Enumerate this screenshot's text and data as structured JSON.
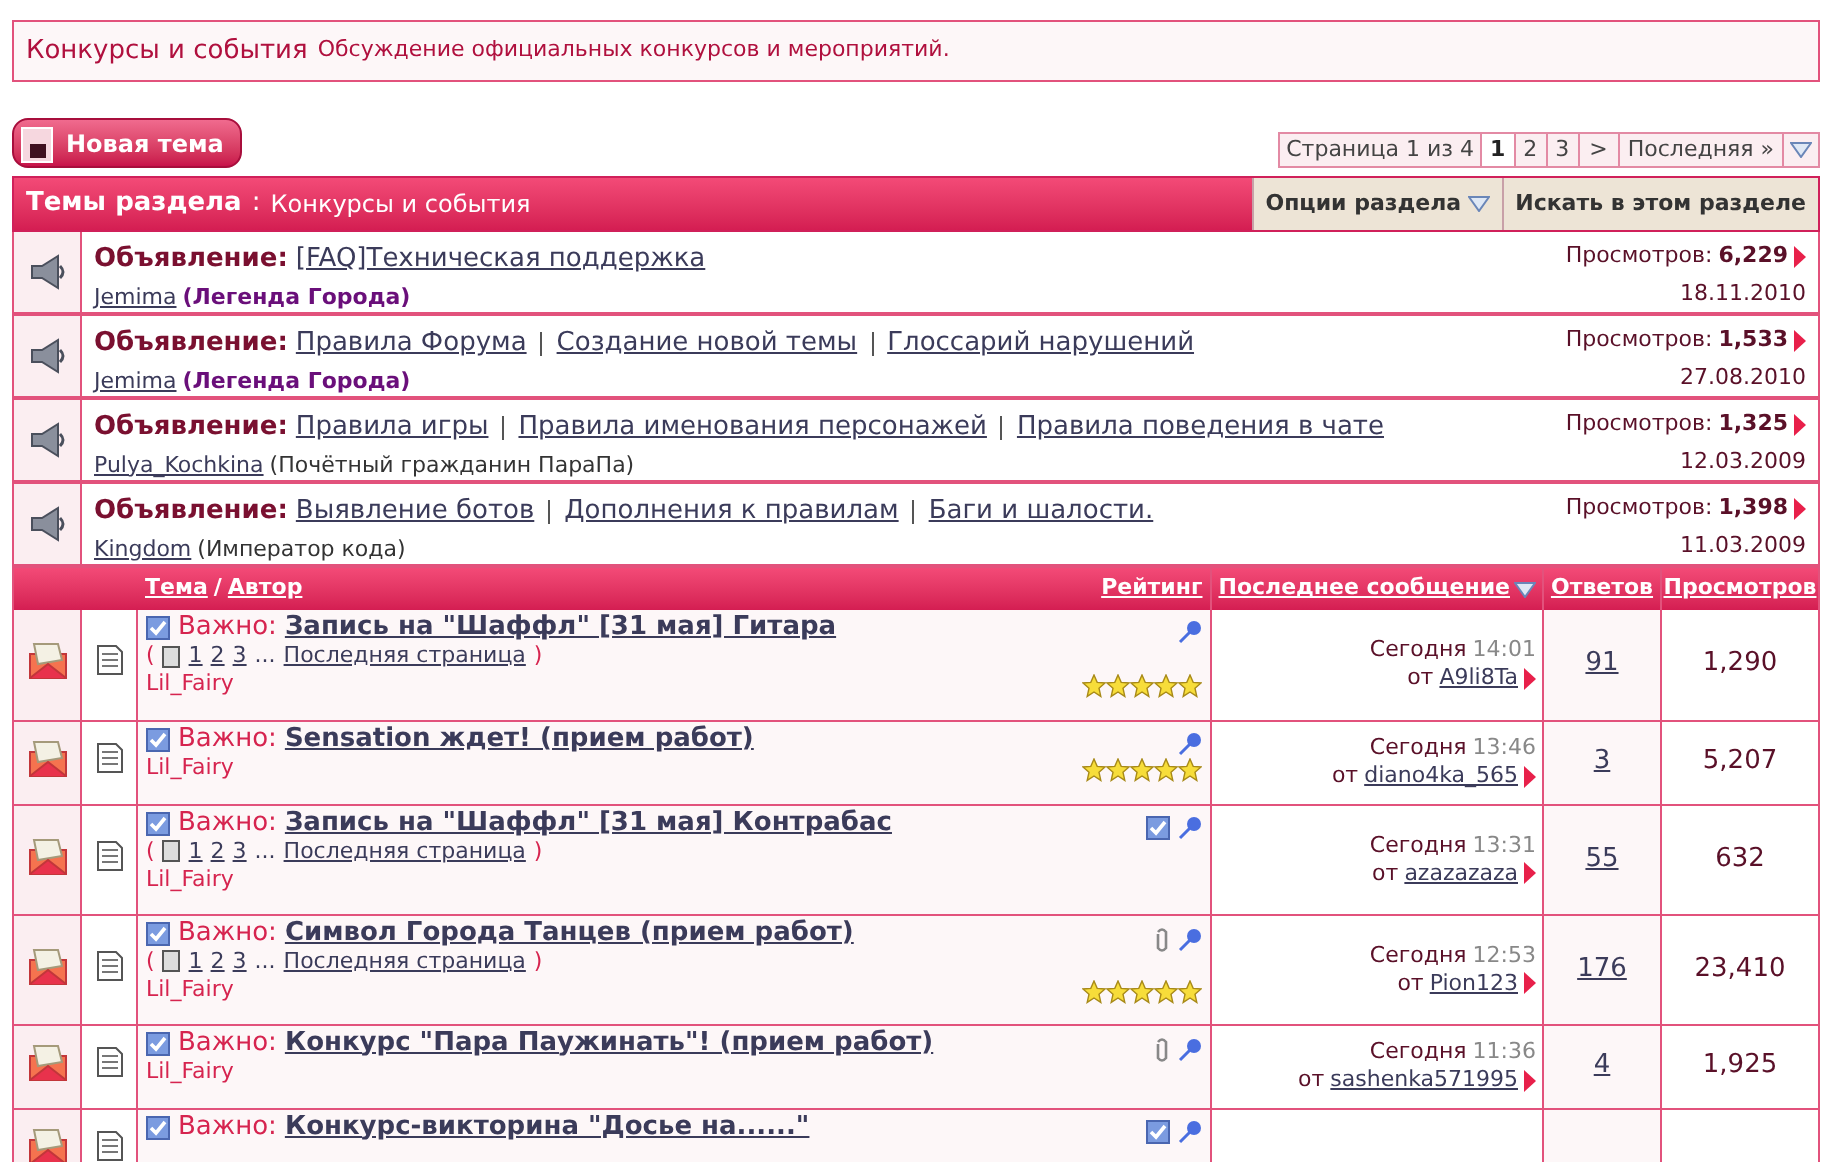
{
  "forum_header": {
    "title": "Конкурсы и события",
    "description": "Обсуждение официальных конкурсов и мероприятий."
  },
  "new_topic_button": "Новая тема",
  "pagination": {
    "label": "Страница 1 из 4",
    "pages": [
      {
        "label": "1",
        "selected": true
      },
      {
        "label": "2",
        "selected": false
      },
      {
        "label": "3",
        "selected": false
      }
    ],
    "next": ">",
    "last": "Последняя",
    "last_arrows": "»"
  },
  "section_bar": {
    "title": "Темы раздела",
    "separator": ":",
    "subtitle": "Конкурсы и события",
    "options": "Опции раздела",
    "search": "Искать в этом разделе"
  },
  "announcements": [
    {
      "label": "Объявление:",
      "links": [
        "[FAQ]Техническая поддержка"
      ],
      "author": "Jemima",
      "rank": "(Легенда Города)",
      "rank_highlighted": true,
      "views_label": "Просмотров:",
      "views": "6,229",
      "date": "18.11.2010"
    },
    {
      "label": "Объявление:",
      "links": [
        "Правила Форума",
        "Создание новой темы",
        "Глоссарий нарушений"
      ],
      "author": "Jemima",
      "rank": "(Легенда Города)",
      "rank_highlighted": true,
      "views_label": "Просмотров:",
      "views": "1,533",
      "date": "27.08.2010"
    },
    {
      "label": "Объявление:",
      "links": [
        "Правила игры",
        "Правила именования персонажей",
        "Правила поведения в чате"
      ],
      "author": "Pulya_Kochkina",
      "rank": "(Почётный гражданин ПараПа)",
      "rank_highlighted": false,
      "views_label": "Просмотров:",
      "views": "1,325",
      "date": "12.03.2009"
    },
    {
      "label": "Объявление:",
      "links": [
        "Выявление ботов",
        "Дополнения к правилам",
        "Баги и шалости."
      ],
      "author": "Kingdom",
      "rank": "(Император кода)",
      "rank_highlighted": false,
      "views_label": "Просмотров:",
      "views": "1,398",
      "date": "11.03.2009"
    }
  ],
  "threads": {
    "columns": {
      "topic": "Тема",
      "slash": "/",
      "author": "Автор",
      "rating": "Рейтинг",
      "last_post": "Последнее сообщение",
      "replies": "Ответов",
      "views": "Просмотров"
    },
    "rows": [
      {
        "prefix": "Важно:",
        "title": "Запись на \"Шаффл\" [31 мая] Гитара",
        "open": "(",
        "pages": [
          "1",
          "2",
          "3"
        ],
        "ellipsis": "...",
        "last_page": "Последняя страница",
        "close": ")",
        "author": "Lil_Fairy",
        "stars": 5,
        "moderated": false,
        "attachment": false,
        "pinned": true,
        "last_day": "Сегодня",
        "last_time": "14:01",
        "by": "от",
        "last_user": "A9li8Ta",
        "replies": "91",
        "views": "1,290"
      },
      {
        "prefix": "Важно:",
        "title": "Sensation ждет! (прием работ)",
        "author": "Lil_Fairy",
        "stars": 5,
        "moderated": false,
        "attachment": false,
        "pinned": true,
        "last_day": "Сегодня",
        "last_time": "13:46",
        "by": "от",
        "last_user": "diano4ka_565",
        "replies": "3",
        "views": "5,207"
      },
      {
        "prefix": "Важно:",
        "title": "Запись на \"Шаффл\" [31 мая] Контрабас",
        "open": "(",
        "pages": [
          "1",
          "2",
          "3"
        ],
        "ellipsis": "...",
        "last_page": "Последняя страница",
        "close": ")",
        "author": "Lil_Fairy",
        "moderated": true,
        "attachment": false,
        "pinned": true,
        "last_day": "Сегодня",
        "last_time": "13:31",
        "by": "от",
        "last_user": "azazazaza",
        "replies": "55",
        "views": "632"
      },
      {
        "prefix": "Важно:",
        "title": "Символ Города Танцев (прием работ)",
        "open": "(",
        "pages": [
          "1",
          "2",
          "3"
        ],
        "ellipsis": "...",
        "last_page": "Последняя страница",
        "close": ")",
        "author": "Lil_Fairy",
        "stars": 5,
        "moderated": false,
        "attachment": true,
        "pinned": true,
        "last_day": "Сегодня",
        "last_time": "12:53",
        "by": "от",
        "last_user": "Pion123",
        "replies": "176",
        "views": "23,410"
      },
      {
        "prefix": "Важно:",
        "title": "Конкурс \"Пара Паужинать\"! (прием работ)",
        "author": "Lil_Fairy",
        "moderated": false,
        "attachment": true,
        "pinned": true,
        "last_day": "Сегодня",
        "last_time": "11:36",
        "by": "от",
        "last_user": "sashenka571995",
        "replies": "4",
        "views": "1,925"
      },
      {
        "prefix": "Важно:",
        "title": "Конкурс-викторина \"Досье на......\"",
        "moderated": true,
        "attachment": false,
        "pinned": true
      }
    ]
  }
}
